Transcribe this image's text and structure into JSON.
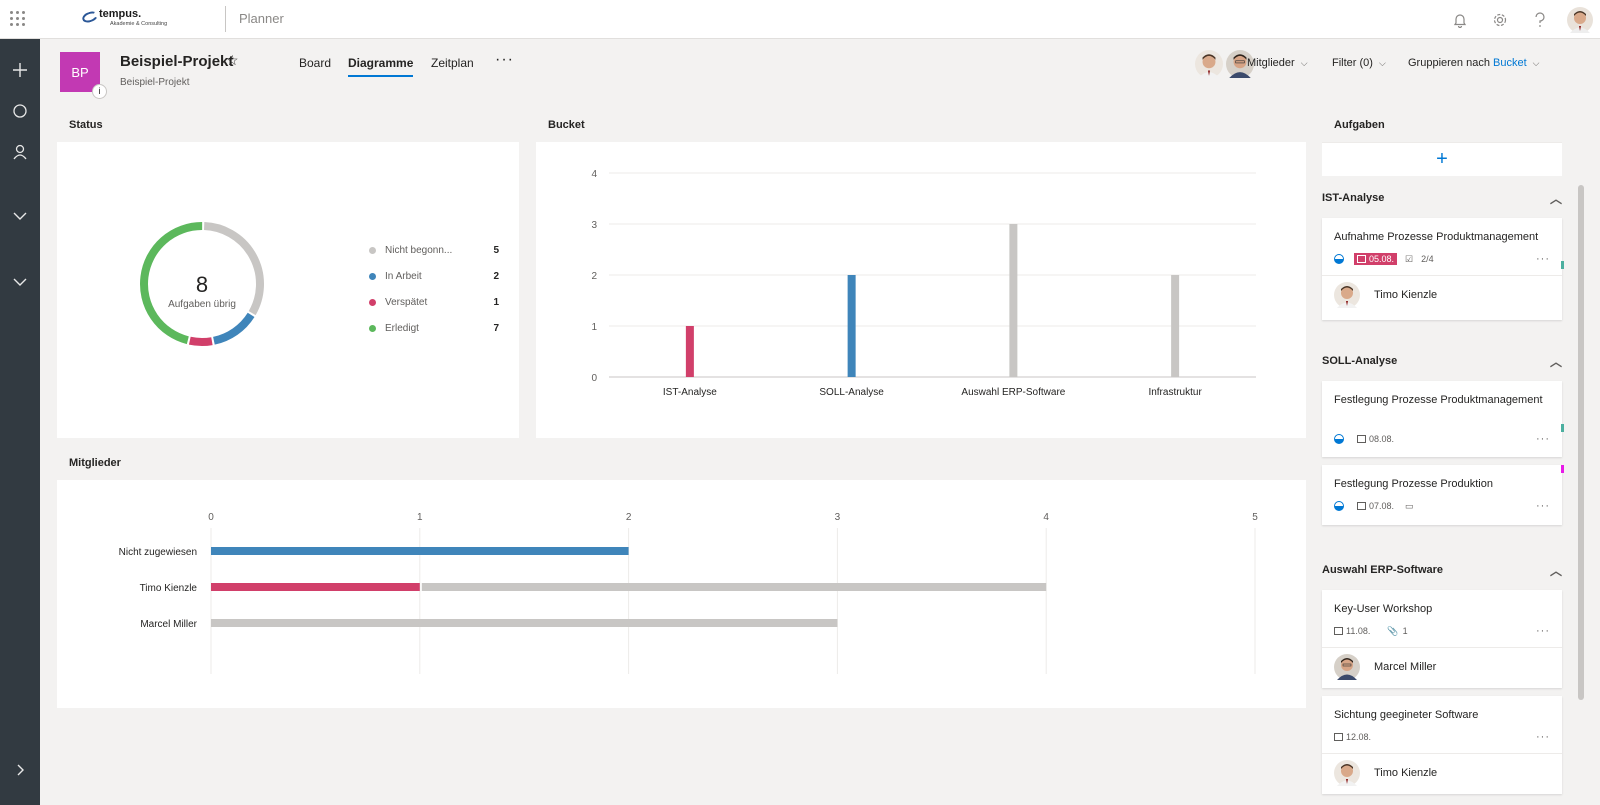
{
  "app": {
    "name": "Planner",
    "logo_name": "tempus.",
    "logo_sub": "Akademie & Consulting"
  },
  "plan": {
    "initials": "BP",
    "title": "Beispiel-Projekt",
    "subtitle": "Beispiel-Projekt",
    "info_glyph": "i"
  },
  "tabs": [
    {
      "label": "Board",
      "active": false
    },
    {
      "label": "Diagramme",
      "active": true
    },
    {
      "label": "Zeitplan",
      "active": false
    }
  ],
  "toolbar": {
    "members": "Mitglieder",
    "filter": "Filter (0)",
    "group_prefix": "Gruppieren nach",
    "group_value": "Bucket"
  },
  "status": {
    "title": "Status",
    "center_number": "8",
    "center_label": "Aufgaben übrig",
    "legend": [
      {
        "label": "Nicht begonn...",
        "count": "5",
        "color": "#c8c6c4"
      },
      {
        "label": "In Arbeit",
        "count": "2",
        "color": "#3f85ba"
      },
      {
        "label": "Verspätet",
        "count": "1",
        "color": "#d13f6a"
      },
      {
        "label": "Erledigt",
        "count": "7",
        "color": "#5cb85c"
      }
    ]
  },
  "chart_data": [
    {
      "type": "pie",
      "title": "Status",
      "categories": [
        "Nicht begonnen",
        "In Arbeit",
        "Verspätet",
        "Erledigt"
      ],
      "values": [
        5,
        2,
        1,
        7
      ],
      "colors": [
        "#c8c6c4",
        "#3f85ba",
        "#d13f6a",
        "#5cb85c"
      ]
    },
    {
      "type": "bar",
      "title": "Bucket",
      "categories": [
        "IST-Analyse",
        "SOLL-Analyse",
        "Auswahl ERP-Software",
        "Infrastruktur"
      ],
      "values": [
        1,
        2,
        3,
        2
      ],
      "colors": [
        "#d13f6a",
        "#3f85ba",
        "#c8c6c4",
        "#c8c6c4"
      ],
      "ylim": [
        0,
        4
      ],
      "yticks": [
        0,
        1,
        2,
        3,
        4
      ]
    },
    {
      "type": "bar",
      "orientation": "horizontal",
      "stacked": true,
      "title": "Mitglieder",
      "categories": [
        "Nicht zugewiesen",
        "Timo Kienzle",
        "Marcel Miller"
      ],
      "series": [
        {
          "values": [
            2,
            0,
            0
          ],
          "color": "#3f85ba"
        },
        {
          "values": [
            0,
            1,
            0
          ],
          "color": "#d13f6a"
        },
        {
          "values": [
            0,
            3,
            3
          ],
          "color": "#c8c6c4"
        }
      ],
      "xlim": [
        0,
        5
      ],
      "xticks": [
        0,
        1,
        2,
        3,
        4,
        5
      ]
    }
  ],
  "bucket_chart": {
    "title": "Bucket"
  },
  "members_chart": {
    "title": "Mitglieder"
  },
  "tasks": {
    "title": "Aufgaben",
    "add_glyph": "+",
    "buckets": [
      {
        "name": "IST-Analyse",
        "items": [
          {
            "title": "Aufnahme Prozesse Produktmanagement",
            "date": "05.08.",
            "late": true,
            "checklist": "2/4",
            "assignee": "Timo Kienzle",
            "label_color": "#4caf9f"
          }
        ]
      },
      {
        "name": "SOLL-Analyse",
        "items": [
          {
            "title": "Festlegung Prozesse Produktmanagement",
            "date": "08.08.",
            "label_color": "#4caf9f"
          },
          {
            "title": "Festlegung Prozesse Produktion",
            "date": "07.08.",
            "comment": true,
            "label_color": "#e81ae8"
          }
        ]
      },
      {
        "name": "Auswahl ERP-Software",
        "items": [
          {
            "title": "Key-User Workshop",
            "date": "11.08.",
            "attachments": "1",
            "assignee": "Marcel Miller"
          },
          {
            "title": "Sichtung geegineter Software",
            "date": "12.08.",
            "assignee": "Timo Kienzle"
          }
        ]
      }
    ]
  },
  "icons": {
    "waffle": "waffle-icon",
    "bell": "bell-icon",
    "gear": "gear-icon",
    "help": "help-icon",
    "plus": "plus-icon",
    "circle": "circle-icon",
    "person": "person-icon",
    "chevron": "chevron-down-icon"
  },
  "glyphs": {
    "more": "···",
    "star": "☆",
    "collapse": "︿",
    "chevron_right": "›",
    "check": "☑",
    "clip": "⌕",
    "comment": "▭",
    "task_more": "···"
  }
}
